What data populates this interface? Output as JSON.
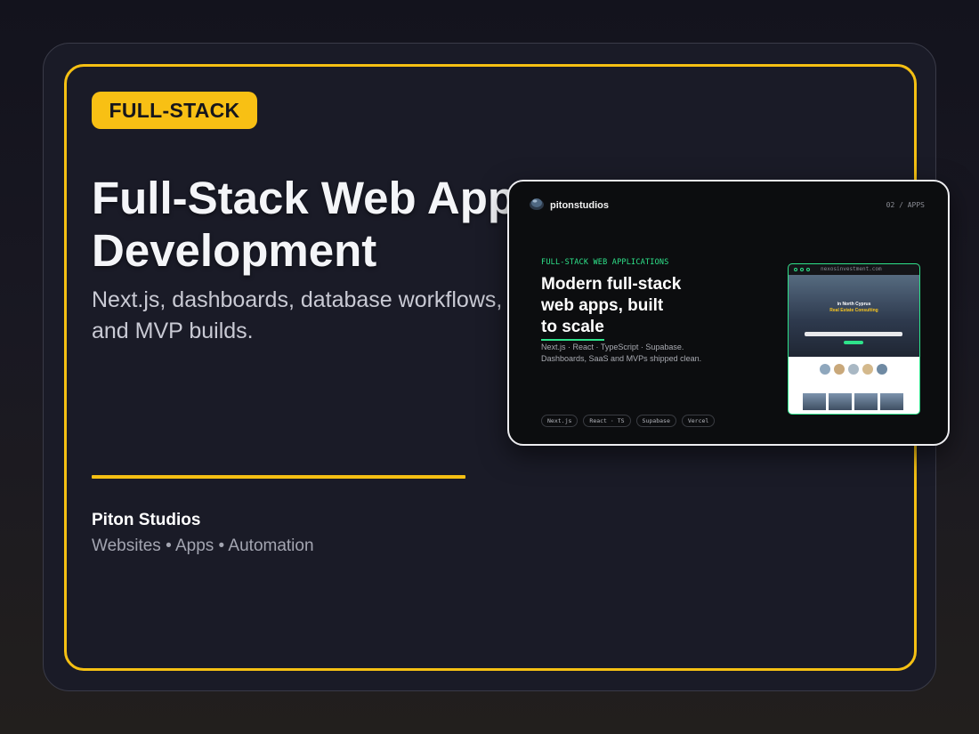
{
  "badge": "FULL-STACK",
  "headline": {
    "line1": "Full-Stack Web Apps",
    "line2": "Development"
  },
  "subtitle": {
    "line1": "Next.js, dashboards, database workflows,",
    "line2": "and MVP builds."
  },
  "footer": {
    "brand": "Piton Studios",
    "tagline": "Websites • Apps • Automation"
  },
  "preview": {
    "brand": "pitonstudios",
    "section": "02 / APPS",
    "eyebrow": "FULL-STACK WEB APPLICATIONS",
    "headline": {
      "line1": "Modern full-stack",
      "line2": "web apps, built",
      "line3": "to scale"
    },
    "desc": {
      "line1": "Next.js · React · TypeScript · Supabase.",
      "line2": "Dashboards, SaaS and MVPs shipped clean."
    },
    "chips": [
      "Next.js",
      "React · TS",
      "Supabase",
      "Vercel"
    ],
    "site": {
      "url": "nexosinvestment.com",
      "hero_title": "in North Cyprus",
      "hero_subtitle": "Real Estate Consulting"
    }
  },
  "colors": {
    "accent": "#f5c013",
    "card_bg": "#1a1b27",
    "preview_accent": "#2ee28a"
  }
}
